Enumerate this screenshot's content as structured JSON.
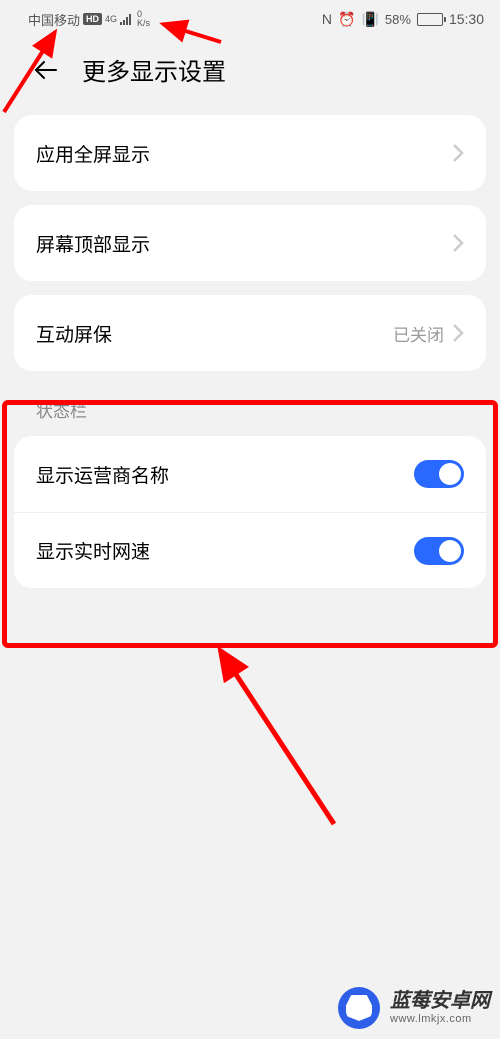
{
  "statusbar": {
    "carrier": "中国移动",
    "hd": "HD",
    "network_type": "4G",
    "netspeed_value": "0",
    "netspeed_unit": "K/s",
    "nfc": "N",
    "battery_pct": "58%",
    "clock": "15:30"
  },
  "header": {
    "title": "更多显示设置"
  },
  "items": {
    "fullscreen": "应用全屏显示",
    "top_display": "屏幕顶部显示",
    "screensaver": "互动屏保",
    "screensaver_status": "已关闭"
  },
  "section": {
    "statusbar_label": "状态栏",
    "show_carrier": "显示运营商名称",
    "show_netspeed": "显示实时网速"
  },
  "watermark": {
    "title": "蓝莓安卓网",
    "sub": "www.lmkjx.com"
  }
}
